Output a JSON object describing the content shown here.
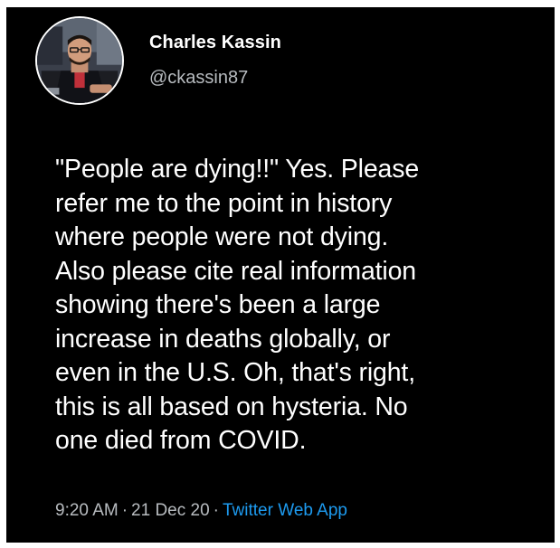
{
  "author": {
    "name": "Charles Kassin",
    "handle": "@ckassin87"
  },
  "tweet": {
    "text": "\"People are dying!!\" Yes. Please\nrefer me to the point in history\nwhere people were not dying.\nAlso please cite real information\nshowing there's been a large\nincrease in deaths globally, or\neven in the U.S. Oh, that's right,\nthis is all based on hysteria. No\none died from COVID."
  },
  "meta": {
    "time": "9:20 AM",
    "separator": "·",
    "date": "21 Dec 20",
    "source": "Twitter Web App"
  },
  "colors": {
    "background": "#000000",
    "text": "#ffffff",
    "secondary": "#b8bcc0",
    "link": "#1d9bf0"
  }
}
